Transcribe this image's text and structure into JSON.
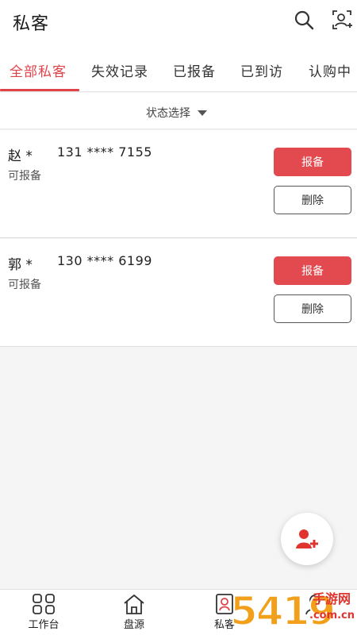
{
  "header": {
    "title": "私客",
    "icons": [
      "search-icon",
      "add-contact-icon"
    ]
  },
  "tabs": [
    {
      "label": "全部私客",
      "active": true
    },
    {
      "label": "失效记录",
      "active": false
    },
    {
      "label": "已报备",
      "active": false
    },
    {
      "label": "已到访",
      "active": false
    },
    {
      "label": "认购中",
      "active": false
    }
  ],
  "filter": {
    "label": "状态选择"
  },
  "customers": [
    {
      "name": "赵 *",
      "phone": "131 **** 7155",
      "status": "可报备",
      "report_label": "报备",
      "delete_label": "删除"
    },
    {
      "name": "郭 *",
      "phone": "130 **** 6199",
      "status": "可报备",
      "report_label": "报备",
      "delete_label": "删除"
    }
  ],
  "fab": {
    "icon": "add-user-icon"
  },
  "nav": [
    {
      "label": "工作台",
      "icon": "grid-icon"
    },
    {
      "label": "盘源",
      "icon": "home-icon"
    },
    {
      "label": "私客",
      "icon": "contact-card-icon",
      "active": true
    },
    {
      "label": "",
      "icon": "profile-icon"
    }
  ],
  "watermark": {
    "digits": "5419",
    "line1": "手游网",
    "line2": ".com.cn"
  },
  "colors": {
    "accent": "#e0424a",
    "report_button": "#e24a50",
    "watermark_orange": "#f2a01c",
    "watermark_red": "#e0342e"
  }
}
